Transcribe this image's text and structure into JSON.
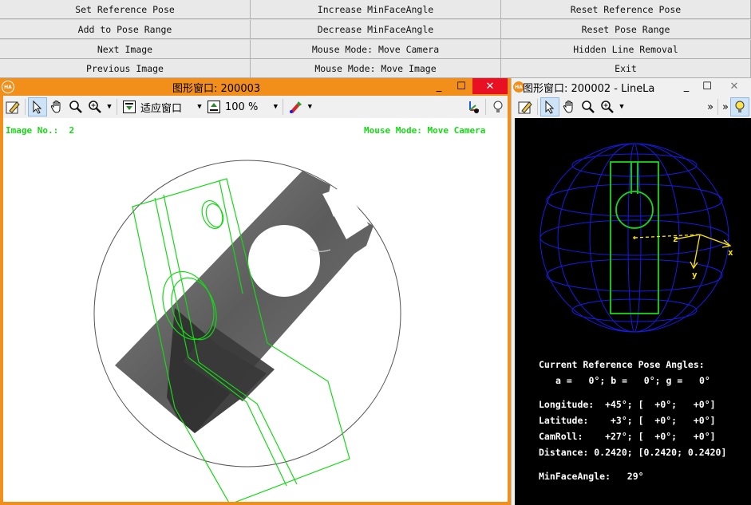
{
  "buttons": {
    "set_reference_pose": "Set Reference Pose",
    "increase_min_face_angle": "Increase MinFaceAngle",
    "reset_reference_pose": "Reset Reference Pose",
    "add_to_pose_range": "Add to Pose Range",
    "decrease_min_face_angle": "Decrease MinFaceAngle",
    "reset_pose_range": "Reset Pose Range",
    "next_image": "Next Image",
    "mouse_mode_move_camera": "Mouse Mode: Move Camera",
    "hidden_line_removal": "Hidden Line Removal",
    "previous_image": "Previous Image",
    "mouse_mode_move_image": "Mouse Mode: Move Image",
    "exit": "Exit"
  },
  "left_window": {
    "title": "图形窗口: 200003",
    "app_icon": "HA",
    "minimize": "_",
    "maximize": "☐",
    "close": "✕",
    "fit_window_label": "适应窗口",
    "zoom_value": "100 %",
    "image_no_label": "Image No.:  2",
    "mouse_mode_label": "Mouse Mode: Move Camera"
  },
  "right_window": {
    "title": "图形窗口: 200002 - LineLa",
    "app_icon": "HA",
    "minimize": "_",
    "maximize": "☐",
    "close": "✕",
    "overflow": "»",
    "axis_x": "x",
    "axis_y": "y",
    "axis_z": "z",
    "info": {
      "current_ref_pose_title": "Current Reference Pose Angles:",
      "angles_line": "a =   0°; b =   0°; g =   0°",
      "longitude": "Longitude:  +45°; [  +0°;   +0°]",
      "latitude": "Latitude:    +3°; [  +0°;   +0°]",
      "camroll": "CamRoll:    +27°; [  +0°;   +0°]",
      "distance": "Distance: 0.2420; [0.2420; 0.2420]",
      "min_face_angle": "MinFaceAngle:   29°"
    }
  },
  "colors": {
    "accent_orange": "#f28e1a",
    "overlay_green": "#16d816",
    "sphere_blue": "#1a1ae6",
    "axis_yellow": "#ffe800"
  },
  "icons": [
    "pencil-icon",
    "pointer-icon",
    "hand-icon",
    "magnifier-icon",
    "zoom-in-icon",
    "fit-window-icon",
    "zoom-percent-icon",
    "color-marker-icon",
    "axis-pose-icon",
    "lightbulb-icon"
  ]
}
